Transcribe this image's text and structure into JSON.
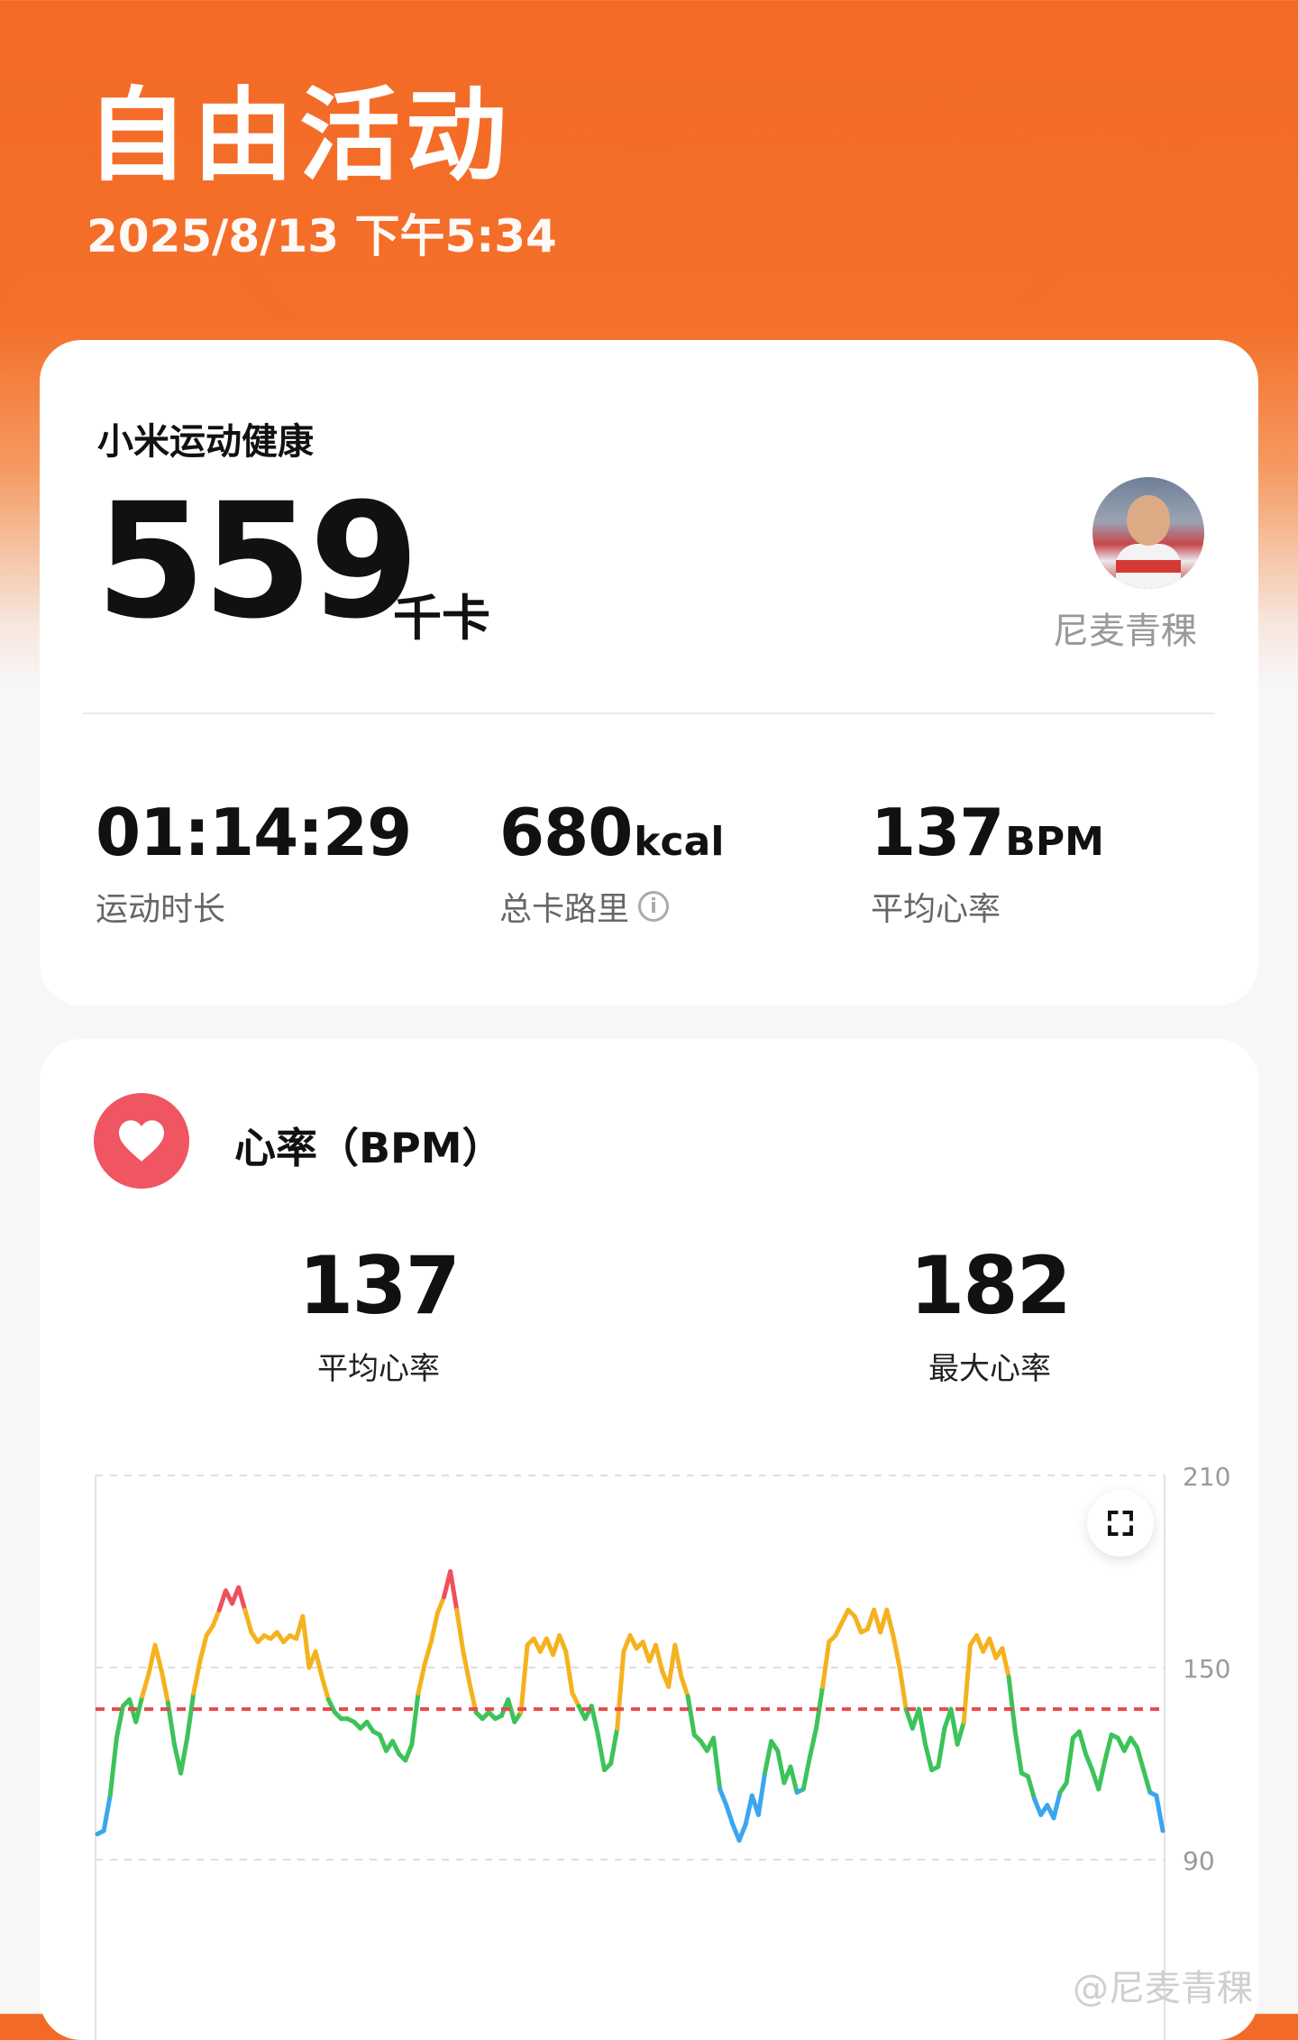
{
  "header": {
    "title": "自由活动",
    "datetime": "2025/8/13 下午5:34"
  },
  "summary": {
    "brand": "小米运动健康",
    "calories": "559",
    "calories_unit": "千卡",
    "username": "尼麦青稞",
    "stats": [
      {
        "value": "01:14:29",
        "unit": "",
        "label": "运动时长"
      },
      {
        "value": "680",
        "unit": "kcal",
        "label": "总卡路里"
      },
      {
        "value": "137",
        "unit": "BPM",
        "label": "平均心率"
      }
    ]
  },
  "heart_rate": {
    "title": "心率（BPM）",
    "avg_value": "137",
    "avg_label": "平均心率",
    "max_value": "182",
    "max_label": "最大心率"
  },
  "watermark": "@尼麦青稞",
  "icons": {
    "heart": "heart-icon",
    "info": "info-icon",
    "expand": "expand-icon"
  },
  "colors": {
    "accent": "#f36a26",
    "zone_blue": "#3aa6f0",
    "zone_green": "#3cc35a",
    "zone_orange": "#f5b21f",
    "zone_red": "#ef4f5c",
    "avg_line": "#e8484f"
  },
  "chart_data": {
    "type": "line",
    "ylabel": "",
    "xlabel": "",
    "y_ticks": [
      90,
      150,
      210
    ],
    "ylim": [
      90,
      210
    ],
    "avg_line": 137,
    "zones": [
      {
        "max": 112,
        "color": "#3aa6f0"
      },
      {
        "max": 140,
        "color": "#3cc35a"
      },
      {
        "max": 170,
        "color": "#f5b21f"
      },
      {
        "max": 999,
        "color": "#ef4f5c"
      }
    ],
    "values": [
      98,
      99,
      110,
      128,
      138,
      140,
      133,
      141,
      148,
      157,
      149,
      139,
      126,
      117,
      128,
      142,
      152,
      160,
      163,
      168,
      174,
      170,
      175,
      168,
      161,
      158,
      160,
      159,
      161,
      158,
      160,
      159,
      166,
      150,
      155,
      147,
      140,
      136,
      134,
      134,
      133,
      131,
      133,
      130,
      129,
      124,
      127,
      123,
      121,
      126,
      142,
      151,
      158,
      167,
      172,
      180,
      168,
      155,
      145,
      136,
      134,
      136,
      134,
      135,
      140,
      133,
      136,
      157,
      159,
      155,
      159,
      154,
      160,
      155,
      142,
      138,
      134,
      138,
      129,
      118,
      120,
      131,
      155,
      160,
      156,
      158,
      152,
      157,
      149,
      144,
      157,
      147,
      141,
      129,
      127,
      124,
      128,
      112,
      107,
      101,
      96,
      101,
      110,
      104,
      117,
      127,
      124,
      114,
      119,
      111,
      112,
      122,
      131,
      144,
      158,
      160,
      164,
      168,
      166,
      161,
      162,
      168,
      161,
      168,
      160,
      150,
      137,
      131,
      137,
      126,
      118,
      119,
      131,
      137,
      126,
      133,
      157,
      160,
      155,
      159,
      153,
      156,
      147,
      130,
      117,
      116,
      109,
      104,
      107,
      103,
      111,
      114,
      128,
      130,
      123,
      118,
      112,
      121,
      129,
      128,
      124,
      128,
      125,
      118,
      111,
      110,
      99
    ]
  }
}
